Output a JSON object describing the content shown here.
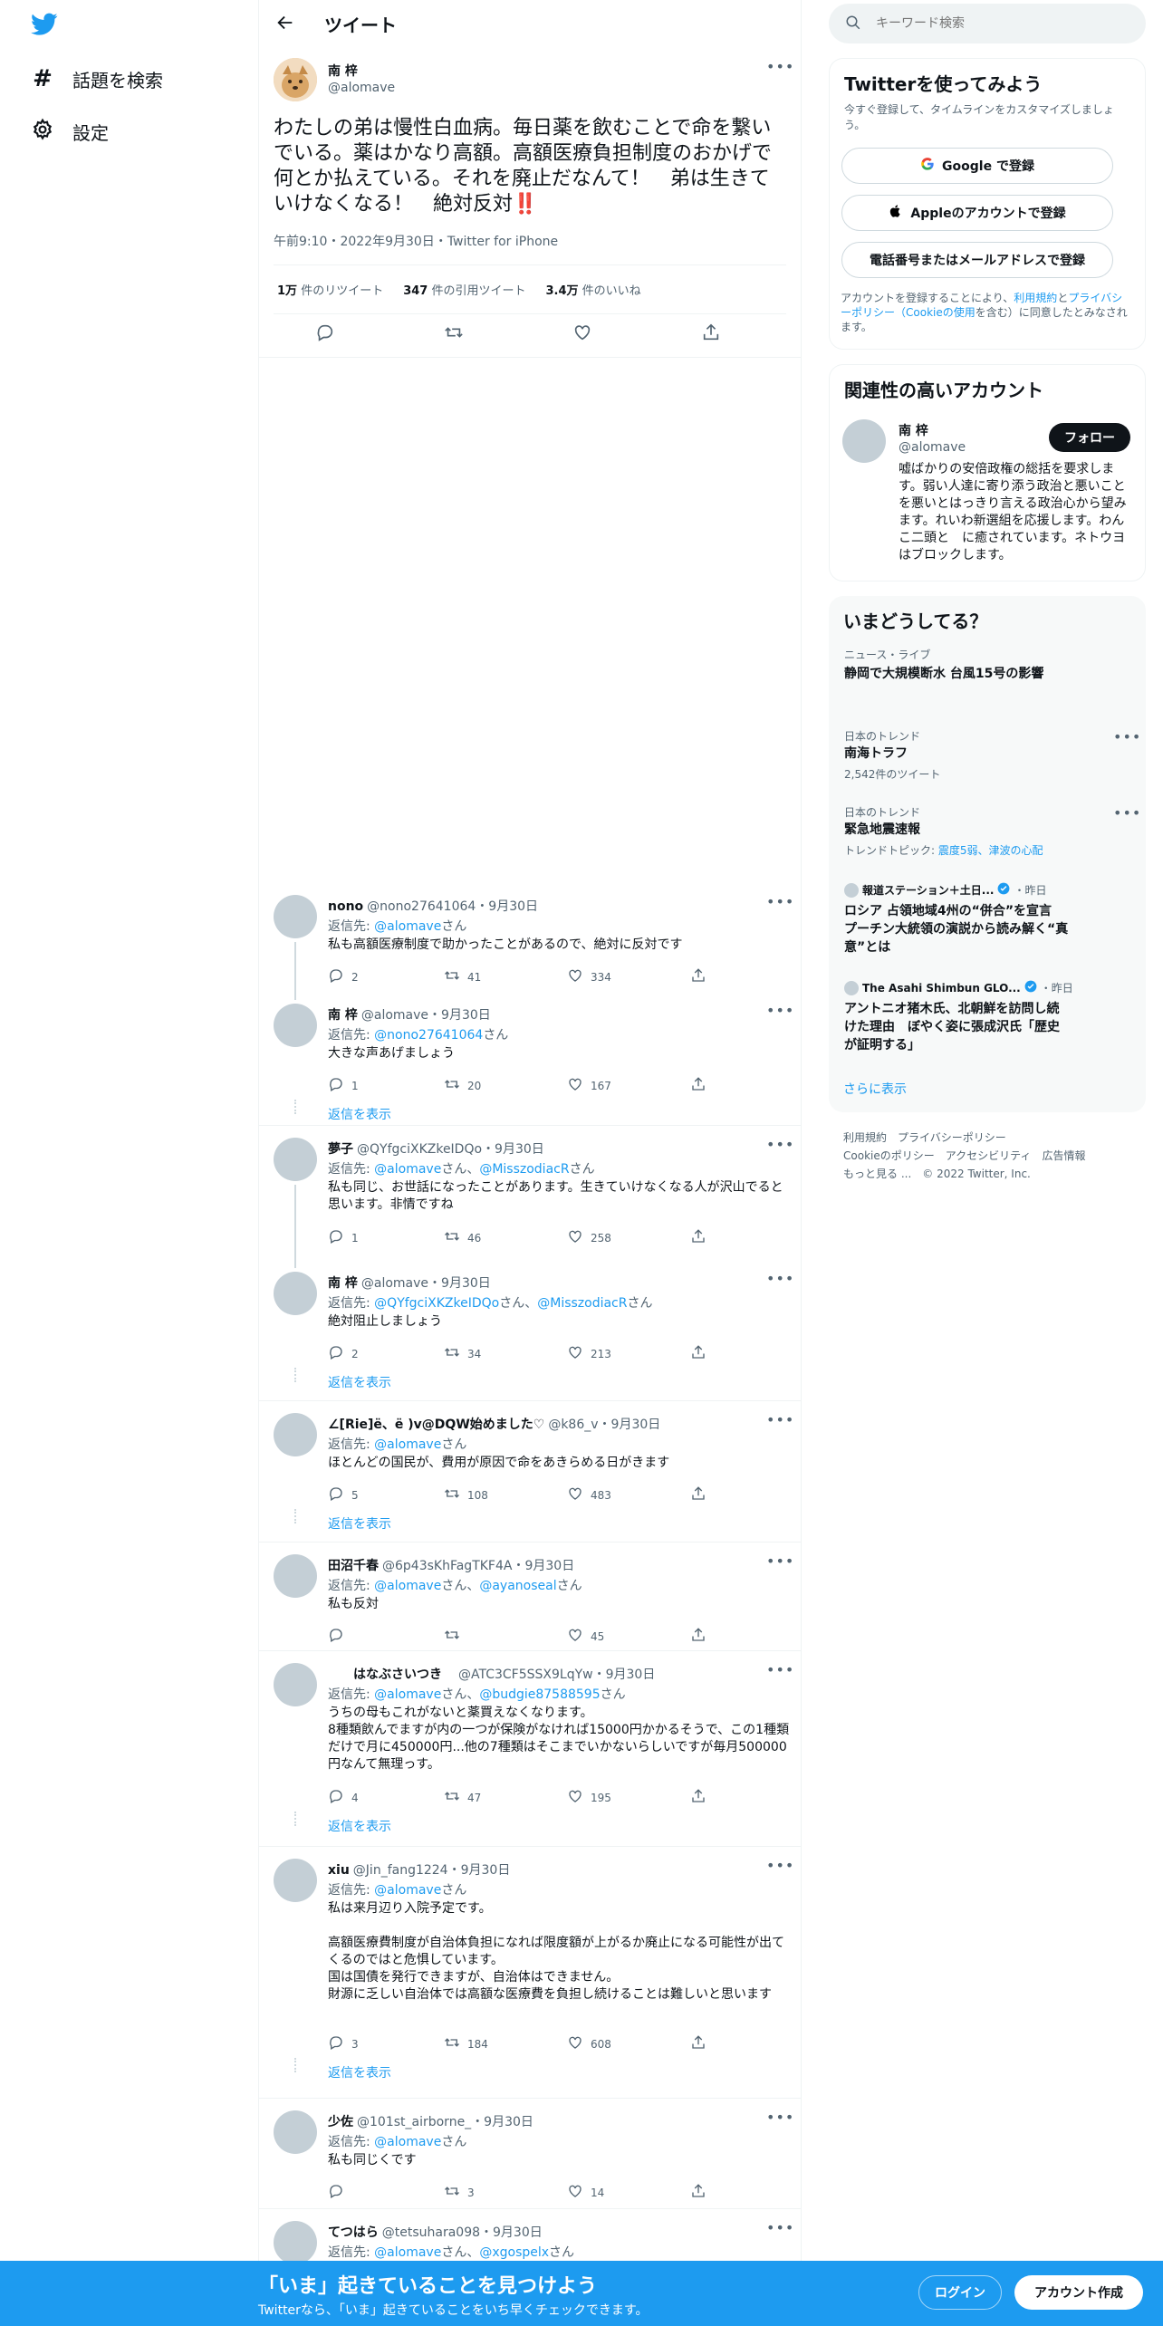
{
  "nav": {
    "explore": "話題を検索",
    "settings": "設定"
  },
  "header": {
    "title": "ツイート"
  },
  "tweet": {
    "name": "南 梓",
    "handle": "@alomave",
    "text": "わたしの弟は慢性白血病。毎日薬を飲むことで命を繋いでいる。薬はかなり高額。高額医療負担制度のおかげで何とか払えている。それを廃止だなんて！　弟は生きていけなくなる！　絶対反対‼️",
    "meta": "午前9:10・2022年9月30日・Twitter for iPhone",
    "stats": [
      {
        "num": "1万",
        "label": "件のリツイート"
      },
      {
        "num": "347",
        "label": "件の引用ツイート"
      },
      {
        "num": "3.4万",
        "label": "件のいいね"
      }
    ]
  },
  "replies": [
    {
      "name": "nono",
      "handle": "@nono27641064",
      "date": "・9月30日",
      "to_prefix": "返信先: ",
      "to": "@alomave",
      "to_suffix": "さん",
      "text": "私も高額医療制度で助かったことがあるので、絶対に反対です",
      "reply": "2",
      "rt": "41",
      "like": "334"
    },
    {
      "name": "南 梓",
      "handle": "@alomave",
      "date": "・9月30日",
      "to_prefix": "返信先: ",
      "to": "@nono27641064",
      "to_suffix": "さん",
      "text": "大きな声あげましょう",
      "reply": "1",
      "rt": "20",
      "like": "167"
    },
    {
      "name": "夢子",
      "handle": "@QYfgciXKZkeIDQo",
      "date": "・9月30日",
      "to_prefix": "返信先: ",
      "to": "@alomave",
      "to_mid": "さん、",
      "to2": "@MisszodiacR",
      "to_suffix": "さん",
      "text": "私も同じ、お世話になったことがあります。生きていけなくなる人が沢山でると思います。非情ですね",
      "reply": "1",
      "rt": "46",
      "like": "258"
    },
    {
      "name": "南 梓",
      "handle": "@alomave",
      "date": "・9月30日",
      "to_prefix": "返信先: ",
      "to": "@QYfgciXKZkeIDQo",
      "to_mid": "さん、",
      "to2": "@MisszodiacR",
      "to_suffix": "さん",
      "text": "絶対阻止しましょう",
      "reply": "2",
      "rt": "34",
      "like": "213"
    },
    {
      "name": "∠[Rie]ё、ё )v@DQW始めました♡",
      "handle": "@k86_v",
      "date": "・9月30日",
      "to_prefix": "返信先: ",
      "to": "@alomave",
      "to_suffix": "さん",
      "text": "ほとんどの国民が、費用が原因で命をあきらめる日がきます",
      "reply": "5",
      "rt": "108",
      "like": "483"
    },
    {
      "name": "田沼千春",
      "handle": "@6p43sKhFagTKF4A",
      "date": "・9月30日",
      "to_prefix": "返信先: ",
      "to": "@alomave",
      "to_mid": "さん、",
      "to2": "@ayanoseal",
      "to_suffix": "さん",
      "text": "私も反対",
      "reply": "",
      "rt": "",
      "like": "45"
    },
    {
      "name": "　　はなぶさいつき　",
      "handle": "@ATC3CF5SSX9LqYw",
      "date": "・9月30日",
      "to_prefix": "返信先: ",
      "to": "@alomave",
      "to_mid": "さん、",
      "to2": "@budgie87588595",
      "to_suffix": "さん",
      "text": "うちの母もこれがないと薬買えなくなります。\n8種類飲んでますが内の一つが保険がなければ15000円かかるそうで、この1種類だけで月に450000円...他の7種類はそこまでいかないらしいですが毎月500000円なんて無理っす。",
      "reply": "4",
      "rt": "47",
      "like": "195"
    },
    {
      "name": "xiu",
      "handle": "@Jin_fang1224",
      "date": "・9月30日",
      "to_prefix": "返信先: ",
      "to": "@alomave",
      "to_suffix": "さん",
      "text": "私は来月辺り入院予定です。\n\n高額医療費制度が自治体負担になれば限度額が上がるか廃止になる可能性が出てくるのではと危惧しています。\n国は国債を発行できますが、自治体はできません。\n財源に乏しい自治体では高額な医療費を負担し続けることは難しいと思います",
      "reply": "3",
      "rt": "184",
      "like": "608"
    },
    {
      "name": "少佐",
      "handle": "@101st_airborne_",
      "date": "・9月30日",
      "to_prefix": "返信先: ",
      "to": "@alomave",
      "to_suffix": "さん",
      "text": "私も同じくです",
      "reply": "",
      "rt": "3",
      "like": "14"
    },
    {
      "name": "てつはら",
      "handle": "@tetsuhara098",
      "date": "・9月30日",
      "to_prefix": "返信先: ",
      "to": "@alomave",
      "to_mid": "さん、",
      "to2": "@xgospelx",
      "to_suffix": "さん",
      "text": "",
      "reply": "",
      "rt": "",
      "like": ""
    }
  ],
  "show_replies": "返信を表示",
  "search": {
    "placeholder": "キーワード検索"
  },
  "signup": {
    "title": "Twitterを使ってみよう",
    "desc": "今すぐ登録して、タイムラインをカスタマイズしましょう。",
    "google": "Google で登録",
    "apple": "Appleのアカウントで登録",
    "phone": "電話番号またはメールアドレスで登録",
    "terms_pre": "アカウントを登録することにより、",
    "terms_link1": "利用規約",
    "terms_mid": "と",
    "terms_link2": "プライバシーポリシー",
    "terms_link3": "（Cookieの使用",
    "terms_post": "を含む）に同意したとみなされます。"
  },
  "related": {
    "title": "関連性の高いアカウント",
    "name": "南 梓",
    "handle": "@alomave",
    "follow": "フォロー",
    "bio": "嘘ばかりの安倍政権の総括を要求します。弱い人達に寄り添う政治と悪いことを悪いとはっきり言える政治心から望みます。れいわ新選組を応援します。わんこ二頭と　に癒されています。ネトウヨはブロックします。"
  },
  "trends": {
    "title": "いまどうしてる？",
    "items": [
      {
        "small": "ニュース・ライブ",
        "title": "静岡で大規模断水 台風15号の影響"
      },
      {
        "small": "日本のトレンド",
        "title": "南海トラフ",
        "sub": "2,542件のツイート"
      },
      {
        "small": "日本のトレンド",
        "title": "緊急地震速報",
        "sub_pre": "トレンドトピック: ",
        "sub_link": "震度5弱、津波の心配"
      },
      {
        "source": "報道ステーション＋土日...",
        "when": "・昨日",
        "title": "ロシア 占領地域4州の“併合”を宣言　プーチン大統領の演説から読み解く“真意”とは"
      },
      {
        "source": "The Asahi Shimbun GLO...",
        "when": "・昨日",
        "title": "アントニオ猪木氏、北朝鮮を訪問し続けた理由　ぼやく姿に張成沢氏「歴史が証明する」"
      }
    ],
    "more": "さらに表示"
  },
  "footer": {
    "l1": "利用規約",
    "l2": "プライバシーポリシー",
    "l3": "Cookieのポリシー",
    "l4": "アクセシビリティ",
    "l5": "広告情報",
    "l6": "もっと見る ...",
    "l7": "© 2022 Twitter, Inc."
  },
  "bottom": {
    "title": "「いま」起きていることを見つけよう",
    "sub": "Twitterなら、「いま」起きていることをいち早くチェックできます。",
    "login": "ログイン",
    "signup": "アカウント作成"
  },
  "colors": {
    "accent": "#1d9bf0",
    "text": "#0f1419",
    "muted": "#536471"
  }
}
